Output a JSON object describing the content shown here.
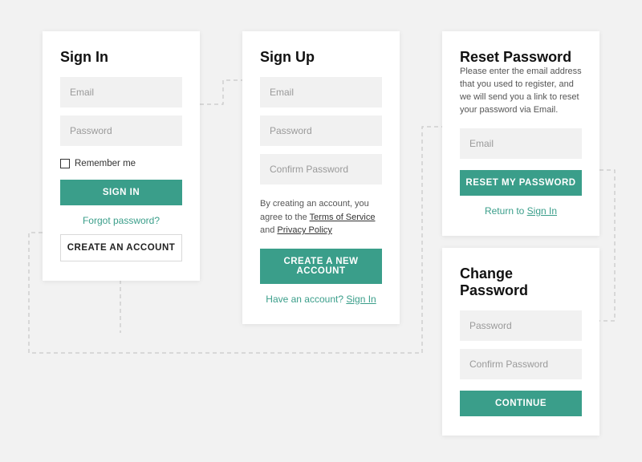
{
  "signin": {
    "title": "Sign In",
    "email_placeholder": "Email",
    "password_placeholder": "Password",
    "remember_label": "Remember me",
    "submit_label": "Sign In",
    "forgot_label": "Forgot password?",
    "create_label": "Create an Account"
  },
  "signup": {
    "title": "Sign Up",
    "email_placeholder": "Email",
    "password_placeholder": "Password",
    "confirm_placeholder": "Confirm Password",
    "terms_prefix": "By creating an account, you agree to the ",
    "terms_link": "Terms of Service",
    "terms_and": " and ",
    "privacy_link": "Privacy Policy",
    "submit_label": "Create a New Account",
    "have_account_prefix": "Have an account? ",
    "have_account_link": "Sign In"
  },
  "reset": {
    "title": "Reset Password",
    "instructions": "Please enter the email address that you used to register, and we will send you a link to reset your password via Email.",
    "email_placeholder": "Email",
    "submit_label": "Reset My Password",
    "return_prefix": "Return to ",
    "return_link": "Sign In"
  },
  "change": {
    "title": "Change Password",
    "password_placeholder": "Password",
    "confirm_placeholder": "Confirm Password",
    "submit_label": "Continue"
  }
}
